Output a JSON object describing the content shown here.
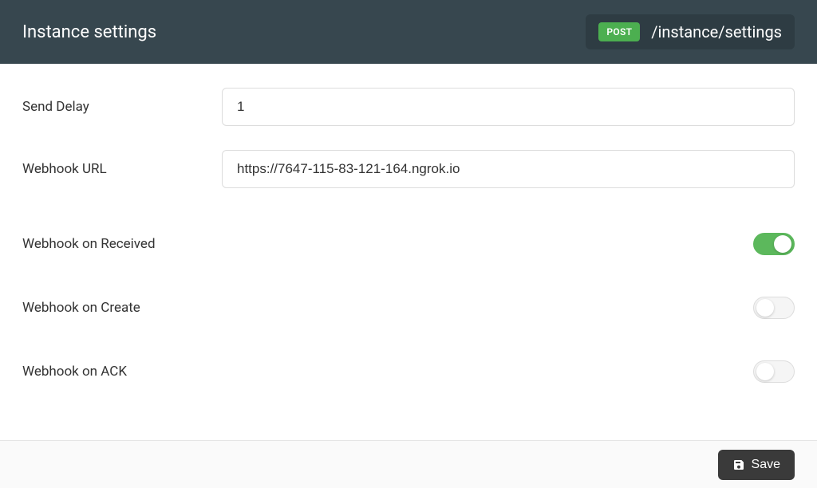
{
  "header": {
    "title": "Instance settings",
    "method": "POST",
    "endpoint": "/instance/settings"
  },
  "fields": {
    "send_delay": {
      "label": "Send Delay",
      "value": "1"
    },
    "webhook_url": {
      "label": "Webhook URL",
      "value": "https://7647-115-83-121-164.ngrok.io"
    }
  },
  "toggles": {
    "received": {
      "label": "Webhook on Received",
      "value": true
    },
    "create": {
      "label": "Webhook on Create",
      "value": false
    },
    "ack": {
      "label": "Webhook on ACK",
      "value": false
    }
  },
  "footer": {
    "save_label": "Save"
  }
}
